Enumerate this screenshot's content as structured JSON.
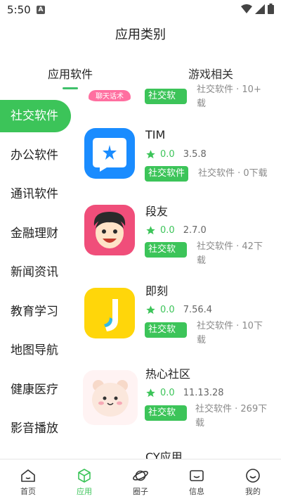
{
  "status_bar": {
    "time": "5:50",
    "notif": "A"
  },
  "header": {
    "title": "应用类别"
  },
  "top_tabs": [
    {
      "label": "应用软件"
    },
    {
      "label": "游戏相关"
    }
  ],
  "sidebar": {
    "items": [
      {
        "label": "社交软件"
      },
      {
        "label": "办公软件"
      },
      {
        "label": "通讯软件"
      },
      {
        "label": "金融理财"
      },
      {
        "label": "新闻资讯"
      },
      {
        "label": "教育学习"
      },
      {
        "label": "地图导航"
      },
      {
        "label": "健康医疗"
      },
      {
        "label": "影音播放"
      }
    ]
  },
  "apps": [
    {
      "name": "",
      "rating": "",
      "version": "",
      "tag": "社交软",
      "meta1": "社交软件 · 10+",
      "meta2": "载",
      "icon_text": "聊天话术"
    },
    {
      "name": "TIM",
      "rating": "0.0",
      "version": "3.5.8",
      "tag": "社交软件",
      "meta1": "社交软件 · 0下载",
      "meta2": ""
    },
    {
      "name": "段友",
      "rating": "0.0",
      "version": "2.7.0",
      "tag": "社交软",
      "meta1": "社交软件 · 42下",
      "meta2": "载"
    },
    {
      "name": "即刻",
      "rating": "0.0",
      "version": "7.56.4",
      "tag": "社交软",
      "meta1": "社交软件 · 10下",
      "meta2": "载"
    },
    {
      "name": "热心社区",
      "rating": "0.0",
      "version": "11.13.28",
      "tag": "社交软",
      "meta1": "社交软件 · 269下",
      "meta2": "载"
    },
    {
      "name": "CY应用",
      "rating": "",
      "version": "",
      "tag": "",
      "meta1": "",
      "meta2": ""
    }
  ],
  "bottom_nav": [
    {
      "label": "首页",
      "icon": "home-icon"
    },
    {
      "label": "应用",
      "icon": "cube-icon"
    },
    {
      "label": "圈子",
      "icon": "planet-icon"
    },
    {
      "label": "信息",
      "icon": "message-icon"
    },
    {
      "label": "我的",
      "icon": "smile-icon"
    }
  ],
  "colors": {
    "accent": "#3cc459",
    "tim_blue": "#1a8cff",
    "duanyou_pink": "#f04e7a",
    "jike_yellow": "#ffd60a"
  }
}
